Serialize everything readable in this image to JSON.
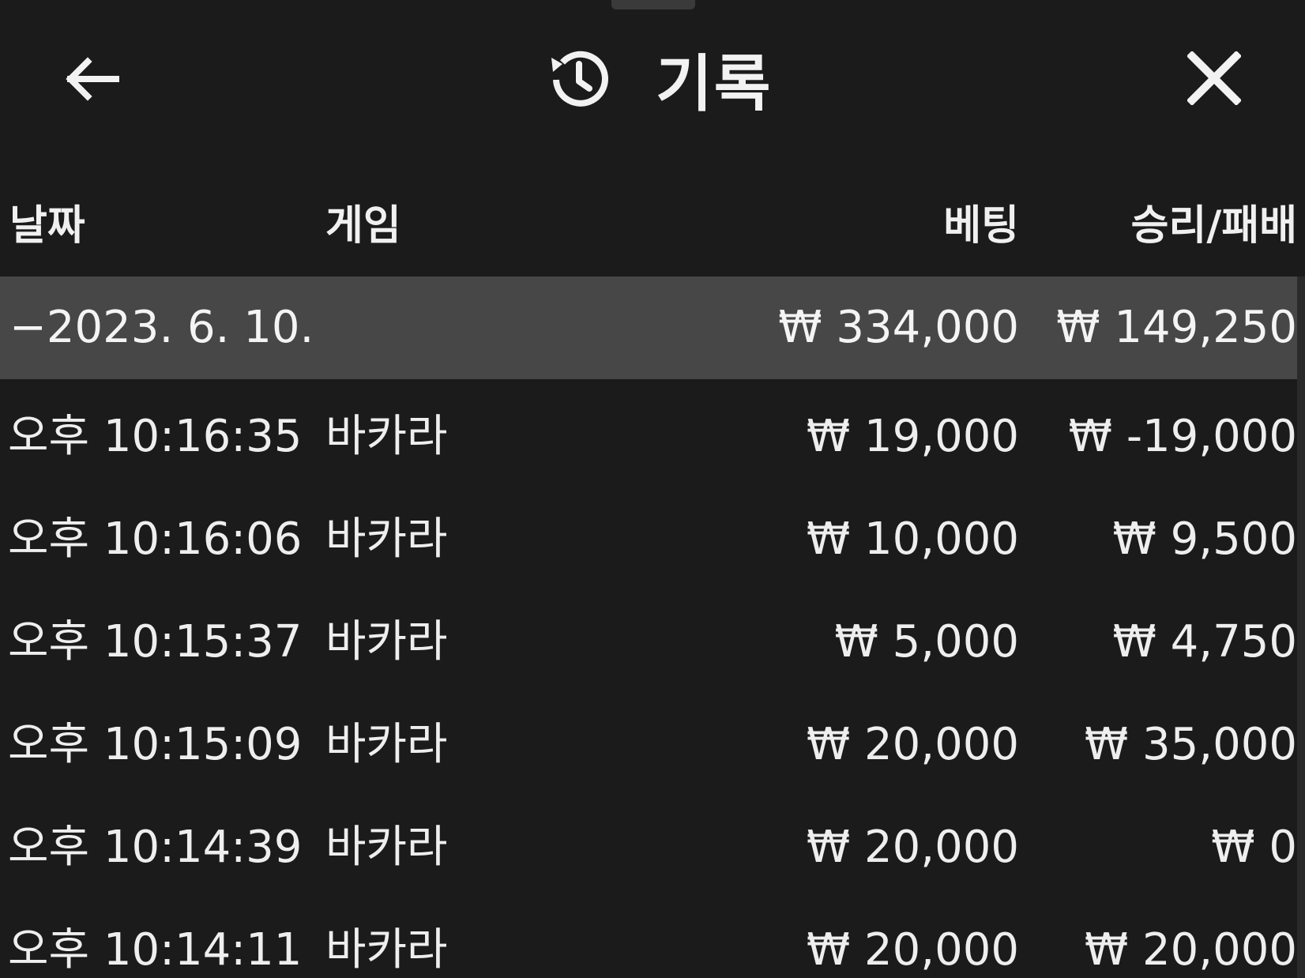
{
  "header": {
    "title": "기록",
    "back_icon": "arrow-left-icon",
    "history_icon": "history-icon",
    "close_icon": "close-icon"
  },
  "columns": {
    "date": "날짜",
    "game": "게임",
    "bet": "베팅",
    "result": "승리/패배"
  },
  "summary": {
    "date": "−2023. 6. 10.",
    "bet": "₩ 334,000",
    "result": "₩ 149,250"
  },
  "rows": [
    {
      "time": "오후 10:16:35",
      "game": "바카라",
      "bet": "₩ 19,000",
      "result": "₩ -19,000"
    },
    {
      "time": "오후 10:16:06",
      "game": "바카라",
      "bet": "₩ 10,000",
      "result": "₩ 9,500"
    },
    {
      "time": "오후 10:15:37",
      "game": "바카라",
      "bet": "₩ 5,000",
      "result": "₩ 4,750"
    },
    {
      "time": "오후 10:15:09",
      "game": "바카라",
      "bet": "₩ 20,000",
      "result": "₩ 35,000"
    },
    {
      "time": "오후 10:14:39",
      "game": "바카라",
      "bet": "₩ 20,000",
      "result": "₩ 0"
    },
    {
      "time": "오후 10:14:11",
      "game": "바카라",
      "bet": "₩ 20,000",
      "result": "₩ 20,000"
    }
  ]
}
